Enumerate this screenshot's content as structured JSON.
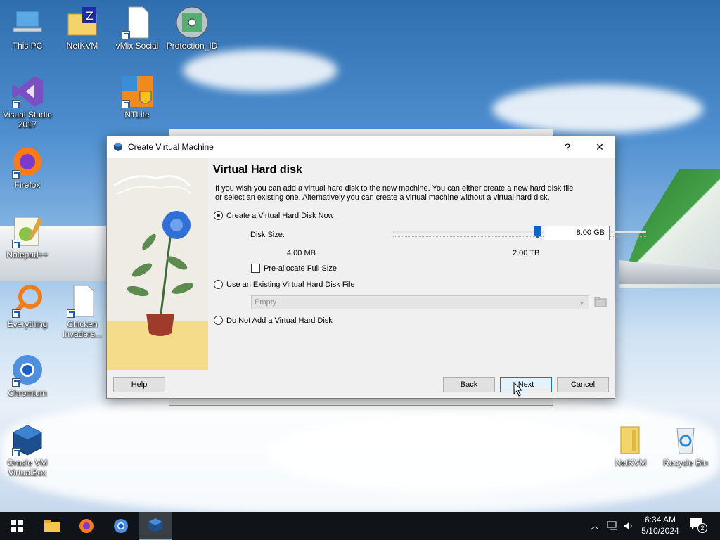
{
  "desktop": {
    "icons": [
      {
        "label": "This PC"
      },
      {
        "label": "NetKVM"
      },
      {
        "label": "vMix Social"
      },
      {
        "label": "Protection_ID"
      },
      {
        "label": "Visual Studio 2017"
      },
      {
        "label": "NTLite"
      },
      {
        "label": "Firefox"
      },
      {
        "label": "Notepad++"
      },
      {
        "label": "Everything"
      },
      {
        "label": "Chicken Invaders..."
      },
      {
        "label": "Chromium"
      },
      {
        "label": "Oracle VM VirtualBox"
      },
      {
        "label": "NetKVM"
      },
      {
        "label": "Recycle Bin"
      }
    ]
  },
  "dialog": {
    "title": "Create Virtual Machine",
    "help_glyph": "?",
    "close_glyph": "✕",
    "heading": "Virtual Hard disk",
    "description": "If you wish you can add a virtual hard disk to the new machine. You can either create a new hard disk file or select an existing one. Alternatively you can create a virtual machine without a virtual hard disk.",
    "option_create": "Create a Virtual Hard Disk Now",
    "disk_size_label": "Disk Size:",
    "disk_size_value": "8.00 GB",
    "slider_min_label": "4.00 MB",
    "slider_max_label": "2.00 TB",
    "slider_position": 0.57,
    "preallocate_label": "Pre-allocate Full Size",
    "option_existing": "Use an Existing Virtual Hard Disk File",
    "existing_combo_value": "Empty",
    "option_none": "Do Not Add a Virtual Hard Disk",
    "buttons": {
      "help": "Help",
      "back": "Back",
      "next": "Next",
      "cancel": "Cancel"
    }
  },
  "taskbar": {
    "time": "6:34 AM",
    "date": "5/10/2024",
    "notification_count": "2"
  }
}
